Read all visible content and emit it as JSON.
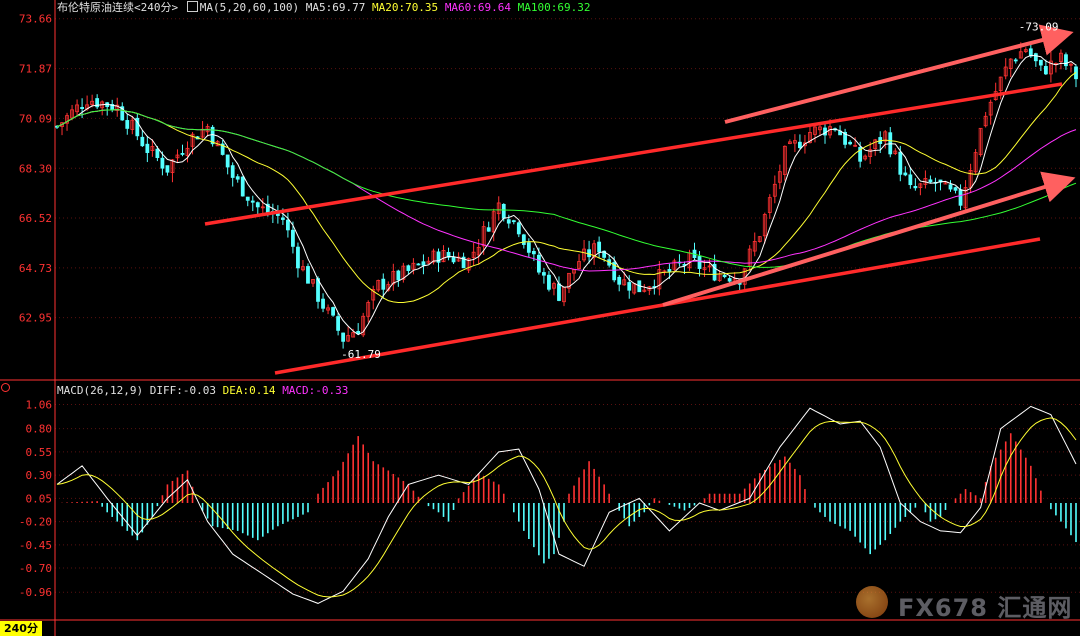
{
  "header": {
    "title": "布伦特原油连续",
    "period": "<240分>",
    "ma_label": "MA(5,20,60,100)",
    "ma5": "MA5:69.77",
    "ma20": "MA20:70.35",
    "ma60": "MA60:69.64",
    "ma100": "MA100:69.32"
  },
  "macd_header": {
    "label": "MACD(26,12,9)",
    "diff": "DIFF:-0.03",
    "dea": "DEA:0.14",
    "macd": "MACD:-0.33"
  },
  "period_tab": "240分",
  "watermark": "FX678 汇通网",
  "colors": {
    "bull": "#ff3232",
    "bear": "#54ffff",
    "ma5": "#ffffff",
    "ma20": "#ffff33",
    "ma60": "#ff33ff",
    "ma100": "#33ff33",
    "axis": "#ff3232",
    "trend": "#ff2a2a",
    "arrow": "#ff6060"
  },
  "chart_data": [
    {
      "type": "candlestick",
      "title": "布伦特原油连续",
      "y_ticks": [
        73.66,
        71.87,
        70.09,
        68.3,
        66.52,
        64.73,
        62.95
      ],
      "ylim": [
        61.0,
        73.9
      ],
      "annotations": [
        {
          "text": "-73.09",
          "value": 73.09,
          "bar": 192
        },
        {
          "text": "-61.79",
          "value": 61.79,
          "bar": 57
        }
      ],
      "price_path": [
        [
          0,
          69.8
        ],
        [
          6,
          70.8
        ],
        [
          12,
          70.5
        ],
        [
          18,
          69.0
        ],
        [
          22,
          68.3
        ],
        [
          26,
          69.3
        ],
        [
          30,
          69.8
        ],
        [
          35,
          68.0
        ],
        [
          40,
          66.9
        ],
        [
          45,
          66.5
        ],
        [
          48,
          65.0
        ],
        [
          53,
          63.4
        ],
        [
          57,
          62.2
        ],
        [
          60,
          62.6
        ],
        [
          64,
          64.1
        ],
        [
          70,
          64.6
        ],
        [
          76,
          65.2
        ],
        [
          82,
          65.0
        ],
        [
          88,
          67.0
        ],
        [
          92,
          66.2
        ],
        [
          96,
          64.6
        ],
        [
          100,
          63.8
        ],
        [
          104,
          65.0
        ],
        [
          108,
          65.5
        ],
        [
          112,
          64.3
        ],
        [
          116,
          64.0
        ],
        [
          120,
          64.4
        ],
        [
          126,
          65.0
        ],
        [
          130,
          64.6
        ],
        [
          136,
          64.4
        ],
        [
          140,
          66.0
        ],
        [
          145,
          68.8
        ],
        [
          150,
          69.6
        ],
        [
          155,
          69.8
        ],
        [
          160,
          68.6
        ],
        [
          165,
          69.5
        ],
        [
          170,
          67.5
        ],
        [
          175,
          67.8
        ],
        [
          180,
          67.1
        ],
        [
          185,
          70.3
        ],
        [
          190,
          72.2
        ],
        [
          193,
          72.6
        ],
        [
          196,
          71.8
        ],
        [
          200,
          72.2
        ],
        [
          203,
          71.6
        ]
      ],
      "series": [
        {
          "name": "MA5",
          "value": 69.77
        },
        {
          "name": "MA20",
          "value": 70.35
        },
        {
          "name": "MA60",
          "value": 69.64
        },
        {
          "name": "MA100",
          "value": 69.32
        }
      ]
    },
    {
      "type": "bar",
      "title": "MACD(26,12,9)",
      "y_ticks": [
        1.06,
        0.8,
        0.55,
        0.3,
        0.05,
        -0.2,
        -0.45,
        -0.7,
        -0.96
      ],
      "ylim": [
        -1.13,
        1.13
      ],
      "diff_path": [
        [
          0,
          0.2
        ],
        [
          5,
          0.4
        ],
        [
          10,
          0.05
        ],
        [
          16,
          -0.35
        ],
        [
          22,
          0.05
        ],
        [
          26,
          0.25
        ],
        [
          30,
          -0.2
        ],
        [
          35,
          -0.55
        ],
        [
          42,
          -0.8
        ],
        [
          47,
          -0.98
        ],
        [
          52,
          -1.08
        ],
        [
          57,
          -0.95
        ],
        [
          62,
          -0.6
        ],
        [
          66,
          -0.15
        ],
        [
          70,
          0.2
        ],
        [
          76,
          0.3
        ],
        [
          82,
          0.2
        ],
        [
          88,
          0.55
        ],
        [
          92,
          0.58
        ],
        [
          96,
          0.15
        ],
        [
          100,
          -0.55
        ],
        [
          105,
          -0.68
        ],
        [
          110,
          -0.1
        ],
        [
          116,
          0.05
        ],
        [
          122,
          -0.3
        ],
        [
          128,
          0.0
        ],
        [
          132,
          -0.08
        ],
        [
          138,
          0.05
        ],
        [
          144,
          0.6
        ],
        [
          150,
          1.02
        ],
        [
          156,
          0.85
        ],
        [
          160,
          0.88
        ],
        [
          164,
          0.6
        ],
        [
          168,
          0.0
        ],
        [
          172,
          -0.2
        ],
        [
          176,
          -0.3
        ],
        [
          180,
          -0.32
        ],
        [
          184,
          -0.05
        ],
        [
          188,
          0.8
        ],
        [
          194,
          1.04
        ],
        [
          198,
          0.95
        ],
        [
          203,
          0.42
        ]
      ],
      "hist_path": [
        [
          0,
          0.0
        ],
        [
          8,
          0.02
        ],
        [
          10,
          -0.1
        ],
        [
          16,
          -0.4
        ],
        [
          19,
          -0.15
        ],
        [
          22,
          0.2
        ],
        [
          26,
          0.35
        ],
        [
          28,
          0.0
        ],
        [
          31,
          -0.25
        ],
        [
          36,
          -0.3
        ],
        [
          40,
          -0.4
        ],
        [
          44,
          -0.25
        ],
        [
          50,
          -0.1
        ],
        [
          52,
          0.1
        ],
        [
          56,
          0.35
        ],
        [
          60,
          0.72
        ],
        [
          63,
          0.45
        ],
        [
          66,
          0.35
        ],
        [
          70,
          0.2
        ],
        [
          73,
          0.0
        ],
        [
          76,
          -0.1
        ],
        [
          78,
          -0.2
        ],
        [
          80,
          0.05
        ],
        [
          84,
          0.32
        ],
        [
          88,
          0.2
        ],
        [
          90,
          0.0
        ],
        [
          93,
          -0.3
        ],
        [
          97,
          -0.65
        ],
        [
          99,
          -0.55
        ],
        [
          101,
          -0.2
        ],
        [
          102,
          0.1
        ],
        [
          106,
          0.45
        ],
        [
          109,
          0.2
        ],
        [
          111,
          0.0
        ],
        [
          114,
          -0.25
        ],
        [
          117,
          -0.1
        ],
        [
          119,
          0.05
        ],
        [
          121,
          0.0
        ],
        [
          125,
          -0.08
        ],
        [
          128,
          0.0
        ],
        [
          130,
          0.1
        ],
        [
          136,
          0.1
        ],
        [
          140,
          0.32
        ],
        [
          145,
          0.5
        ],
        [
          148,
          0.3
        ],
        [
          150,
          0.0
        ],
        [
          154,
          -0.2
        ],
        [
          158,
          -0.3
        ],
        [
          162,
          -0.55
        ],
        [
          165,
          -0.4
        ],
        [
          168,
          -0.2
        ],
        [
          172,
          0.0
        ],
        [
          174,
          -0.2
        ],
        [
          176,
          -0.15
        ],
        [
          178,
          0.0
        ],
        [
          181,
          0.15
        ],
        [
          184,
          0.05
        ],
        [
          186,
          0.4
        ],
        [
          190,
          0.75
        ],
        [
          194,
          0.4
        ],
        [
          197,
          0.0
        ],
        [
          200,
          -0.2
        ],
        [
          203,
          -0.42
        ]
      ]
    }
  ]
}
